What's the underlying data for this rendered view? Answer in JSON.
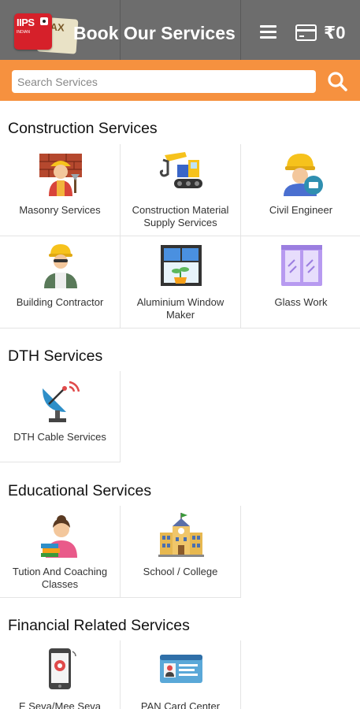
{
  "header": {
    "logo_text": "IIPS",
    "logo_small": "INDIAN",
    "logo_tax": "TAX",
    "title": "Book Our Services",
    "wallet_amount": "₹0"
  },
  "search": {
    "placeholder": "Search Services",
    "value": ""
  },
  "colors": {
    "header_bg": "#6d6d6d",
    "search_bg": "#f6913f",
    "logo_red": "#d6202a"
  },
  "sections": [
    {
      "title": "Construction Services",
      "items": [
        {
          "label": "Masonry Services",
          "icon": "mason-worker-icon"
        },
        {
          "label": "Construction Material Supply Services",
          "icon": "excavator-icon"
        },
        {
          "label": "Civil Engineer",
          "icon": "civil-engineer-icon"
        },
        {
          "label": "Building Contractor",
          "icon": "contractor-icon"
        },
        {
          "label": "Aluminium Window Maker",
          "icon": "window-icon"
        },
        {
          "label": "Glass Work",
          "icon": "glass-panel-icon"
        }
      ]
    },
    {
      "title": "DTH Services",
      "items": [
        {
          "label": "DTH Cable Services",
          "icon": "satellite-dish-icon"
        }
      ]
    },
    {
      "title": "Educational Services",
      "items": [
        {
          "label": "Tution And Coaching Classes",
          "icon": "tutor-icon"
        },
        {
          "label": "School / College",
          "icon": "school-building-icon"
        }
      ]
    },
    {
      "title": "Financial Related Services",
      "items": [
        {
          "label": "E Seva/Mee Seva",
          "icon": "mobile-service-icon"
        },
        {
          "label": "PAN Card Center",
          "icon": "pan-card-icon"
        }
      ]
    }
  ]
}
